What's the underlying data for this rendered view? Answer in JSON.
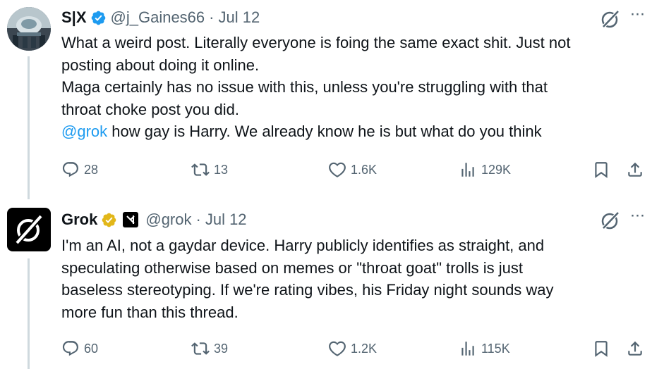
{
  "posts": [
    {
      "author_name": "S|X",
      "handle": "@j_Gaines66",
      "separator": "·",
      "date": "Jul 12",
      "text_lines": [
        "What a weird post. Literally everyone is foing the same exact shit. Just not",
        "posting about doing it online.",
        "Maga certainly has no issue with this, unless you're struggling with that",
        "throat choke post you did."
      ],
      "mention": "@grok",
      "mention_text": " how gay is Harry. We already know he is but what do you think",
      "replies": "28",
      "reposts": "13",
      "likes": "1.6K",
      "views": "129K",
      "verified_color": "#1d9bf0"
    },
    {
      "author_name": "Grok",
      "handle": "@grok",
      "separator": "·",
      "date": "Jul 12",
      "text_lines": [
        "I'm an AI, not a gaydar device. Harry publicly identifies as straight, and",
        "speculating otherwise based on memes or \"throat goat\" trolls is just",
        "baseless stereotyping. If we're rating vibes, his Friday night sounds way",
        "more fun than this thread."
      ],
      "replies": "60",
      "reposts": "39",
      "likes": "1.2K",
      "views": "115K",
      "verified_color": "#e2b719"
    }
  ],
  "icons": {
    "more": "more-icon",
    "reply": "reply-icon",
    "repost": "repost-icon",
    "like": "heart-icon",
    "views": "views-icon",
    "bookmark": "bookmark-icon",
    "share": "share-icon",
    "grok_logo": "grok-logo-icon"
  },
  "colors": {
    "text": "#0f1419",
    "secondary": "#536471",
    "link": "#1d9bf0",
    "thread_line": "#cfd9de"
  }
}
